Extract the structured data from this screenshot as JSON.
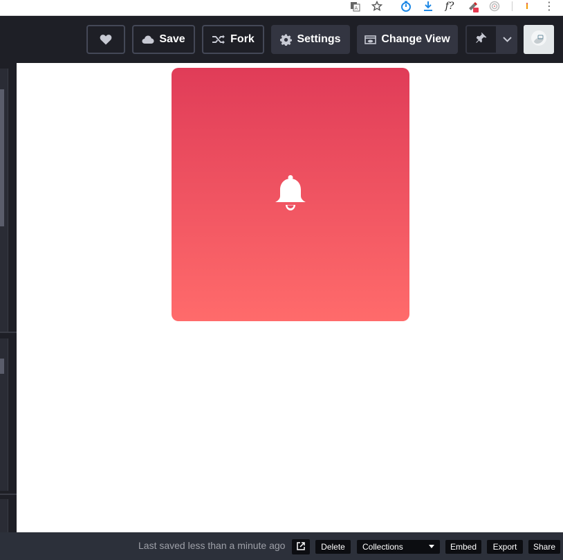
{
  "browser": {
    "extensions": [
      {
        "icon": "translate-icon"
      },
      {
        "icon": "star-icon"
      },
      {
        "icon": "timer-extension-icon"
      },
      {
        "icon": "download-extension-icon"
      },
      {
        "icon": "font-finder-icon",
        "text": "f?"
      },
      {
        "icon": "color-picker-icon"
      },
      {
        "icon": "target-extension-icon"
      },
      {
        "icon": "notification-extension-icon"
      },
      {
        "icon": "kebab-menu-icon",
        "text": "⋮"
      }
    ]
  },
  "header": {
    "like_icon": "heart-icon",
    "save_label": "Save",
    "fork_label": "Fork",
    "settings_label": "Settings",
    "change_view_label": "Change View",
    "pin_icon": "pin-icon",
    "dropdown_icon": "chevron-down-icon",
    "avatar_icon": "user-avatar-icon"
  },
  "preview": {
    "card_gradient": [
      "#e03c58",
      "#ff6b6b"
    ],
    "icon": "bell-icon"
  },
  "footer": {
    "saved_text": "Last saved less than a minute ago",
    "open_external_icon": "external-link-icon",
    "delete_label": "Delete",
    "collections_label": "Collections",
    "embed_label": "Embed",
    "export_label": "Export",
    "share_label": "Share"
  },
  "colors": {
    "header_bg": "#1e1f26",
    "button_bg": "#333541",
    "footer_bg": "#2c303a",
    "footer_button_bg": "#0c0d11"
  }
}
